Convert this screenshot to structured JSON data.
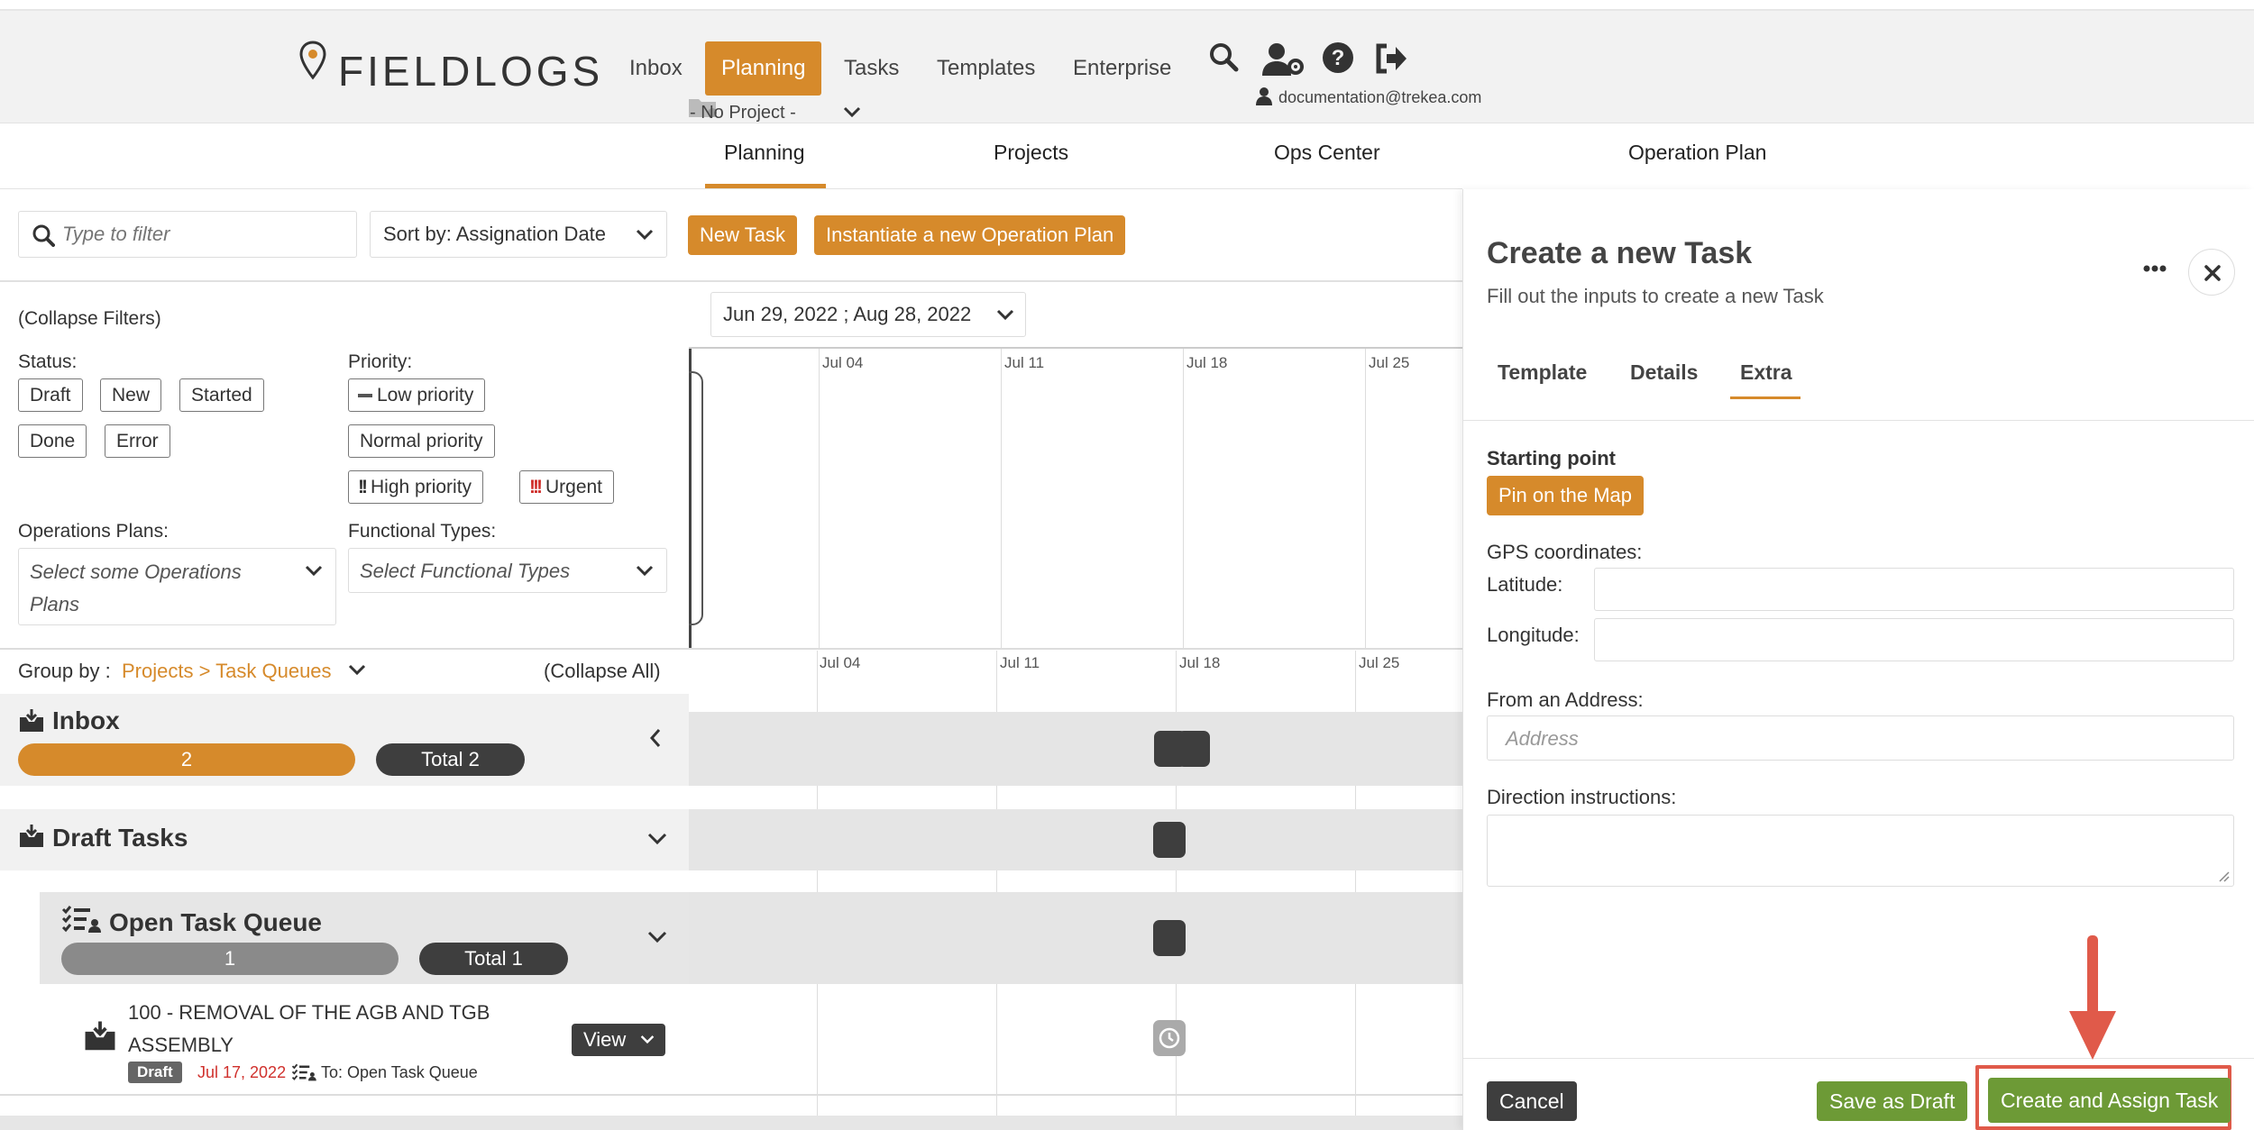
{
  "header": {
    "logo_text": "FIELDLOGS",
    "nav": [
      "Inbox",
      "Planning",
      "Tasks",
      "Templates",
      "Enterprise"
    ],
    "project_selector": "- No Project -",
    "user_email": "documentation@trekea.com"
  },
  "subnav": {
    "tabs": [
      "Planning",
      "Projects",
      "Ops Center",
      "Operation Plan"
    ],
    "active": "Planning"
  },
  "toolbar": {
    "filter_placeholder": "Type to filter",
    "sort_label": "Sort by: Assignation Date",
    "new_task": "New Task",
    "instantiate": "Instantiate a new Operation Plan"
  },
  "filters": {
    "collapse": "(Collapse Filters)",
    "status_label": "Status:",
    "status": [
      "Draft",
      "New",
      "Started",
      "Done",
      "Error"
    ],
    "priority_label": "Priority:",
    "priority": [
      "Low priority",
      "Normal priority",
      "High priority",
      "Urgent"
    ],
    "ops_label": "Operations Plans:",
    "ops_placeholder": "Select some Operations Plans",
    "func_label": "Functional Types:",
    "func_placeholder": "Select Functional Types"
  },
  "gantt": {
    "date_range": "Jun 29, 2022 ; Aug 28, 2022",
    "dates": [
      "Jul 04",
      "Jul 11",
      "Jul 18",
      "Jul 25"
    ]
  },
  "groups": {
    "group_by_label": "Group by :",
    "group_by_value": "Projects > Task Queues",
    "collapse_all": "(Collapse All)",
    "inbox": {
      "title": "Inbox",
      "count": "2",
      "total": "Total 2"
    },
    "draft": {
      "title": "Draft Tasks"
    },
    "queue": {
      "title": "Open Task Queue",
      "count": "1",
      "total": "Total 1"
    },
    "task": {
      "title": "100 - REMOVAL OF THE AGB AND TGB ASSEMBLY",
      "status": "Draft",
      "date": "Jul 17, 2022",
      "to": "To: Open Task Queue",
      "view": "View"
    }
  },
  "panel": {
    "title": "Create a new Task",
    "subtitle": "Fill out the inputs to create a new Task",
    "tabs": [
      "Template",
      "Details",
      "Extra"
    ],
    "active_tab": "Extra",
    "starting_point": "Starting point",
    "pin_btn": "Pin on the Map",
    "gps_label": "GPS coordinates:",
    "latitude": "Latitude:",
    "longitude": "Longitude:",
    "address_label": "From an Address:",
    "address_placeholder": "Address",
    "direction_label": "Direction instructions:",
    "cancel": "Cancel",
    "save_draft": "Save as Draft",
    "create_assign": "Create and Assign Task"
  },
  "colors": {
    "accent": "#d68a2b",
    "green": "#6d9a36",
    "dark": "#3e3e3e",
    "highlight": "#e05a4a",
    "urgent": "#d0312d"
  }
}
